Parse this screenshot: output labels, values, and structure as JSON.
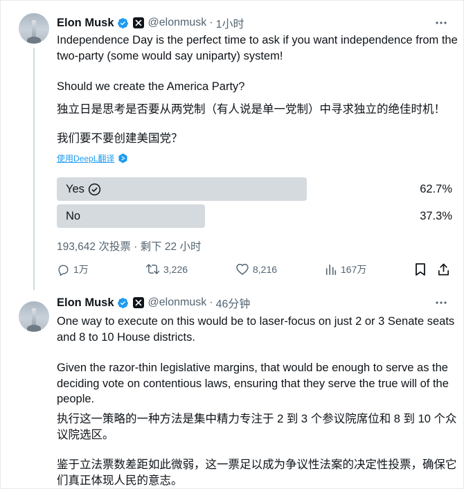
{
  "tweets": [
    {
      "author": {
        "name": "Elon Musk",
        "handle": "@elonmusk",
        "time": "1小时"
      },
      "text": {
        "en_p1": "Independence Day is the perfect time to ask if you want independence from the two-party (some would say uniparty) system!",
        "en_p2": "Should we create the America Party?",
        "zh_p1": "独立日是思考是否要从两党制（有人说是单一党制）中寻求独立的绝佳时机！",
        "zh_p2": "我们要不要创建美国党？"
      },
      "translate_label": "使用DeepL翻译",
      "poll": {
        "options": [
          {
            "label": "Yes",
            "percent": "62.7%",
            "fraction": 0.627,
            "selected": true
          },
          {
            "label": "No",
            "percent": "37.3%",
            "fraction": 0.373,
            "selected": false
          }
        ],
        "meta": "193,642 次投票 · 剩下 22 小时"
      },
      "actions": {
        "replies": "1万",
        "reposts": "3,226",
        "likes": "8,216",
        "views": "167万"
      }
    },
    {
      "author": {
        "name": "Elon Musk",
        "handle": "@elonmusk",
        "time": "46分钟"
      },
      "text": {
        "en_p1": "One way to execute on this would be to laser-focus on just 2 or 3 Senate seats and 8 to 10 House districts.",
        "en_p2": "Given the razor-thin legislative margins, that would be enough to serve as the deciding vote on contentious laws, ensuring that they serve the true will of the people.",
        "zh_p1": "执行这一策略的一种方法是集中精力专注于 2 到 3 个参议院席位和 8 到 10 个众议院选区。",
        "zh_p2": "鉴于立法票数差距如此微弱，这一票足以成为争议性法案的决定性投票，确保它们真正体现人民的意志。"
      }
    }
  ],
  "colors": {
    "accent": "#1d9bf0",
    "text": "#0f1419",
    "muted": "#536471",
    "poll_bar": "#d5dade"
  },
  "icons": [
    "avatar",
    "verified-badge-icon",
    "x-logo-icon",
    "more-icon",
    "check-circle-icon",
    "deepl-icon",
    "reply-icon",
    "repost-icon",
    "like-icon",
    "views-icon",
    "bookmark-icon",
    "share-icon"
  ]
}
